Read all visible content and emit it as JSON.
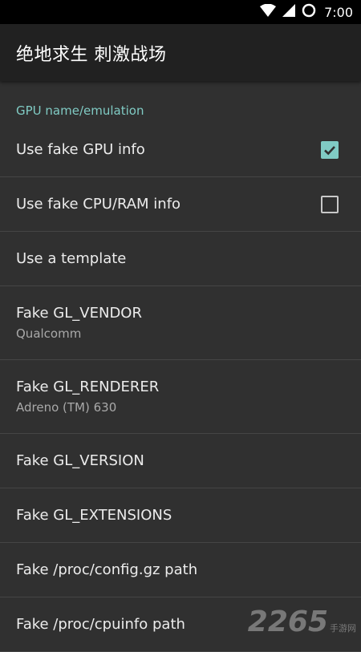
{
  "status_bar": {
    "time": "7:00"
  },
  "app_bar": {
    "title": "绝地求生 刺激战场"
  },
  "section": {
    "header": "GPU name/emulation"
  },
  "prefs": [
    {
      "label": "Use fake GPU info",
      "checked": true
    },
    {
      "label": "Use fake CPU/RAM info",
      "checked": false
    },
    {
      "label": "Use a template"
    },
    {
      "label": "Fake GL_VENDOR",
      "summary": "Qualcomm"
    },
    {
      "label": "Fake GL_RENDERER",
      "summary": "Adreno (TM) 630"
    },
    {
      "label": "Fake GL_VERSION"
    },
    {
      "label": "Fake GL_EXTENSIONS"
    },
    {
      "label": "Fake /proc/config.gz path"
    },
    {
      "label": "Fake /proc/cpuinfo path"
    }
  ],
  "watermark": {
    "number": "2265",
    "sub": "手游网"
  },
  "colors": {
    "accent": "#80cbc4",
    "background": "#303030",
    "app_bar": "#212121"
  }
}
